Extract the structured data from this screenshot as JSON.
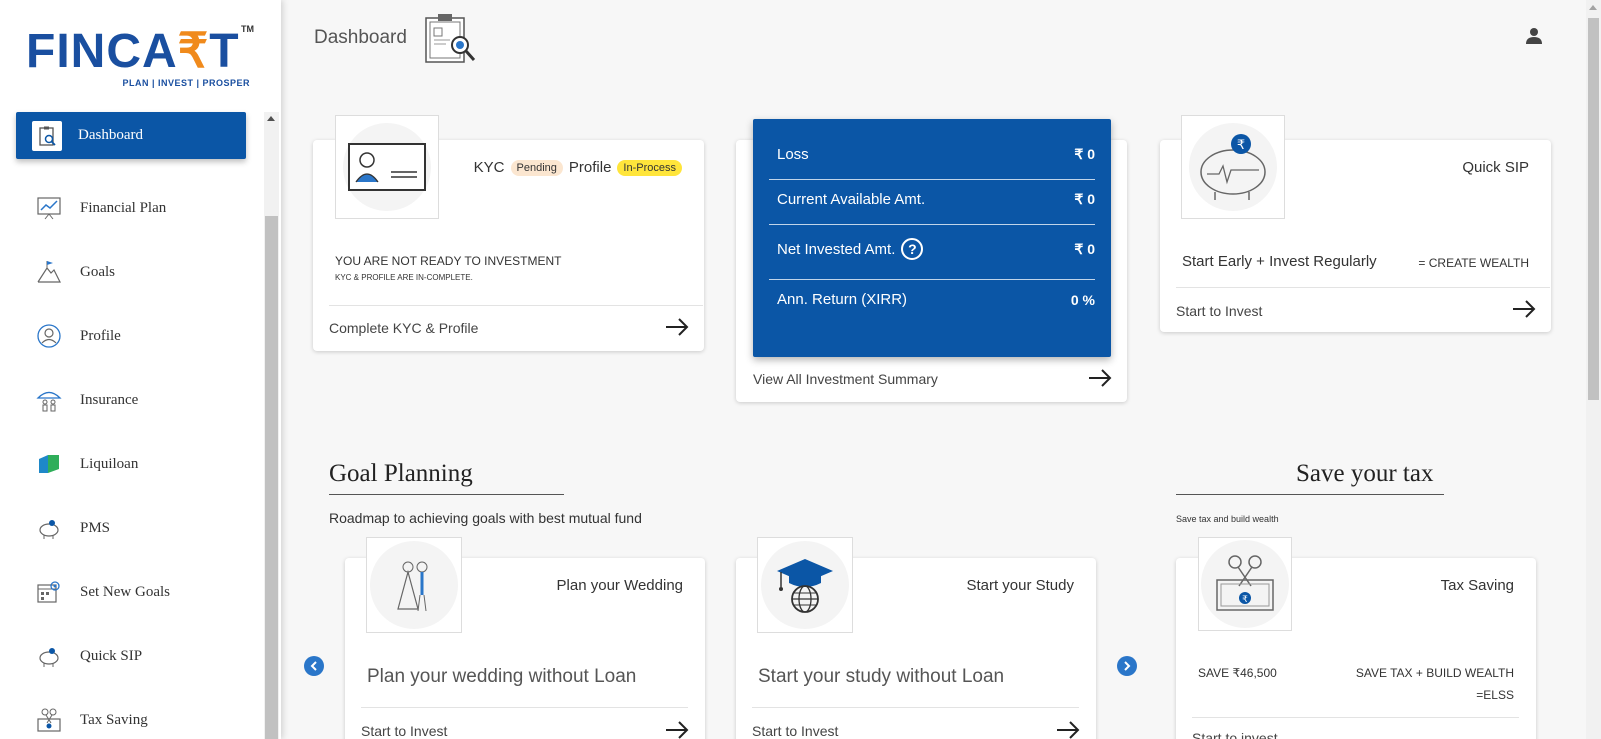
{
  "brand": {
    "name_part1": "FINCA",
    "name_rupee": "₹",
    "name_part2": "T",
    "tm": "TM",
    "tagline": "PLAN | INVEST | PROSPER"
  },
  "sidebar": {
    "items": [
      {
        "label": "Dashboard",
        "icon": "dashboard-icon",
        "active": true
      },
      {
        "label": "Financial Plan",
        "icon": "chart-icon"
      },
      {
        "label": "Goals",
        "icon": "mountain-flag-icon"
      },
      {
        "label": "Profile",
        "icon": "user-circle-icon"
      },
      {
        "label": "Insurance",
        "icon": "umbrella-family-icon"
      },
      {
        "label": "Liquiloan",
        "icon": "liquiloan-icon"
      },
      {
        "label": "PMS",
        "icon": "piggy-bank-icon"
      },
      {
        "label": "Set New Goals",
        "icon": "calendar-target-icon"
      },
      {
        "label": "Quick SIP",
        "icon": "piggy-bank-icon"
      },
      {
        "label": "Tax Saving",
        "icon": "scissors-money-icon"
      }
    ]
  },
  "header": {
    "title": "Dashboard",
    "icon": "clipboard-search-icon",
    "user_icon": "person-icon"
  },
  "kyc_card": {
    "kyc_label": "KYC",
    "kyc_status": "Pending",
    "profile_label": "Profile",
    "profile_status": "In-Process",
    "warning": "YOU ARE NOT READY TO INVESTMENT",
    "warning_sub": "KYC & PROFILE ARE IN-COMPLETE.",
    "link": "Complete KYC & Profile"
  },
  "investment_card": {
    "rows": [
      {
        "label": "Loss",
        "value": "₹ 0"
      },
      {
        "label": "Current Available Amt.",
        "value": "₹ 0"
      },
      {
        "label": "Net Invested Amt.",
        "value": "₹ 0",
        "help": "?"
      },
      {
        "label": "Ann. Return (XIRR)",
        "value": "0 %"
      }
    ],
    "link": "View All Investment Summary"
  },
  "quick_sip_card": {
    "title": "Quick SIP",
    "tagline": "Start Early + Invest Regularly",
    "wealth": "= CREATE WEALTH",
    "link": "Start to Invest"
  },
  "goal_planning": {
    "heading": "Goal Planning",
    "subheading": "Roadmap to achieving goals with best mutual fund",
    "cards": [
      {
        "title": "Plan your Wedding",
        "big": "Plan your wedding without Loan",
        "link": "Start to Invest"
      },
      {
        "title": "Start your Study",
        "big": "Start your study without Loan",
        "link": "Start to Invest"
      }
    ]
  },
  "save_tax": {
    "heading": "Save your tax",
    "subheading": "Save tax and build wealth",
    "card": {
      "title": "Tax Saving",
      "save": "SAVE ₹46,500",
      "tagline_1": "SAVE TAX + BUILD WEALTH",
      "tagline_2": "=ELSS",
      "link": "Start to invest"
    }
  },
  "colors": {
    "primary": "#0b56a6",
    "accent": "#f08a1c",
    "pending_badge": "#fbe6d0",
    "inprocess_badge": "#ffe53b"
  }
}
